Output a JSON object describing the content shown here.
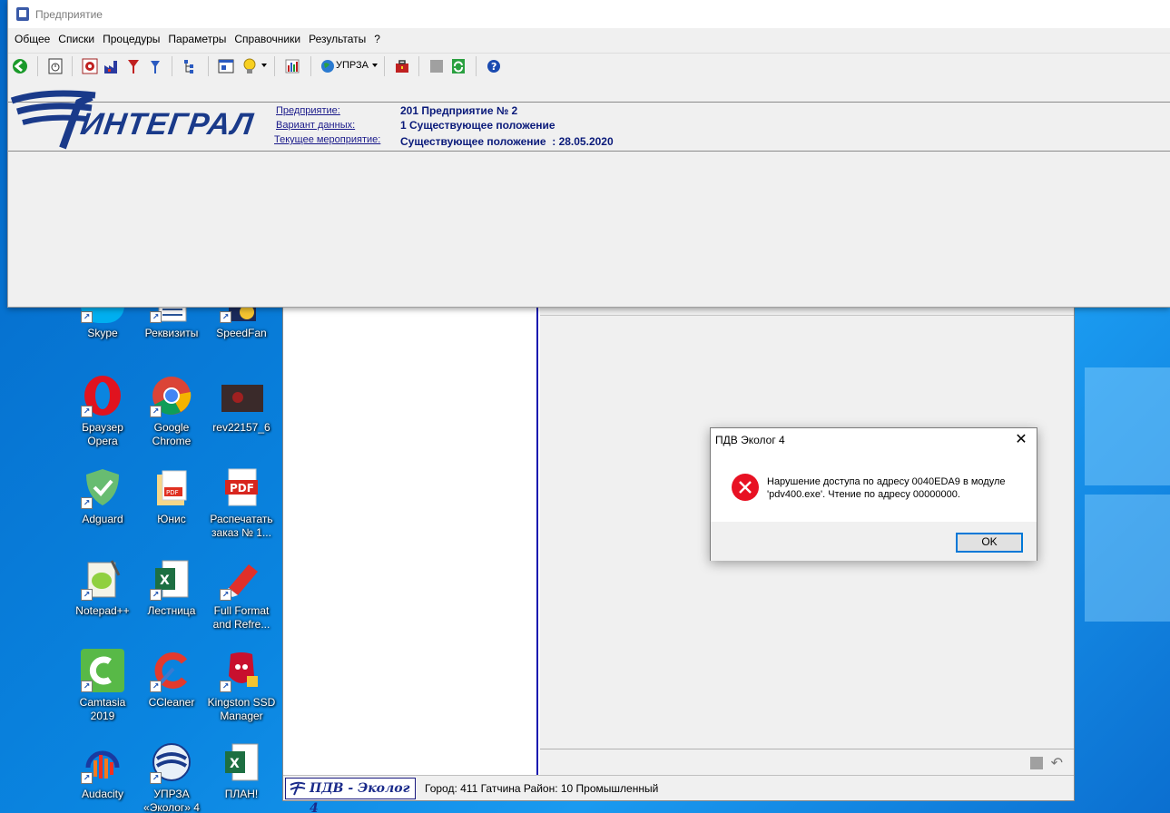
{
  "app": {
    "title": "Предприятие"
  },
  "menu": [
    "Общее",
    "Списки",
    "Процедуры",
    "Параметры",
    "Справочники",
    "Результаты",
    "?"
  ],
  "toolbar": {
    "upr_label": "УПРЗА"
  },
  "banner": {
    "logo_text": "ИНТЕГРАЛ",
    "labels": {
      "enterprise": "Предприятие:",
      "variant": "Вариант данных:",
      "measure": "Текущее мероприятие:"
    },
    "values": {
      "enterprise": "201 Предприятие № 2",
      "variant": "1 Существующее положение",
      "measure": "Существующее положение  : 28.05.2020"
    }
  },
  "dialog": {
    "title": "ПДВ Эколог 4",
    "message": "Нарушение доступа по адресу 0040EDA9 в модуле 'pdv400.exe'. Чтение по адресу 00000000.",
    "ok_label": "OK"
  },
  "statusbar": {
    "logo_text": "ПДВ - Эколог 4",
    "text": "Город: 411 Гатчина Район: 10 Промышленный"
  },
  "desktop_icons": [
    {
      "label": "Skype"
    },
    {
      "label": "Реквизиты"
    },
    {
      "label": "SpeedFan"
    },
    {
      "label": "Браузер Opera"
    },
    {
      "label": "Google Chrome"
    },
    {
      "label": "rev22157_6"
    },
    {
      "label": "Adguard"
    },
    {
      "label": "Юнис"
    },
    {
      "label": "Распечатать заказ № 1..."
    },
    {
      "label": "Notepad++"
    },
    {
      "label": "Лестница"
    },
    {
      "label": "Full Format and Refre..."
    },
    {
      "label": "Camtasia 2019"
    },
    {
      "label": "CCleaner"
    },
    {
      "label": "Kingston SSD Manager"
    },
    {
      "label": "Audacity"
    },
    {
      "label": "УПРЗА «Эколог» 4"
    },
    {
      "label": "ПЛАН!"
    }
  ],
  "colors": {
    "desktop_blue": "#0a85e0",
    "banner_text": "#0a1a7a",
    "error_red": "#e81123",
    "accent": "#0078d7"
  }
}
